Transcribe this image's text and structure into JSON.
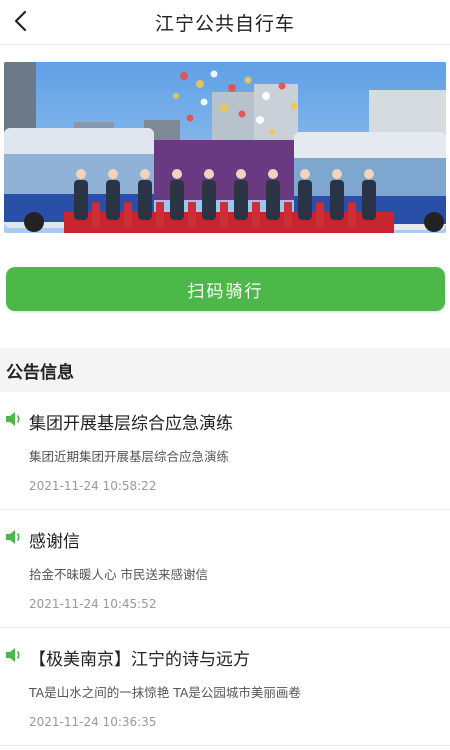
{
  "header": {
    "title": "江宁公共自行车",
    "back_icon": "chevron-left-icon"
  },
  "banner": {
    "image": "bike-launch-ceremony-photo"
  },
  "cta": {
    "label": "扫码骑行",
    "color": "#4db84a"
  },
  "announcements": {
    "heading": "公告信息",
    "items": [
      {
        "icon": "speaker-icon",
        "title": "集团开展基层综合应急演练",
        "summary": "集团近期集团开展基层综合应急演练",
        "time": "2021-11-24 10:58:22"
      },
      {
        "icon": "speaker-icon",
        "title": "感谢信",
        "summary": "拾金不昧暖人心 市民送来感谢信",
        "time": "2021-11-24 10:45:52"
      },
      {
        "icon": "speaker-icon",
        "title": "【极美南京】江宁的诗与远方",
        "summary": "TA是山水之间的一抹惊艳 TA是公园城市美丽画卷",
        "time": "2021-11-24 10:36:35"
      }
    ]
  }
}
